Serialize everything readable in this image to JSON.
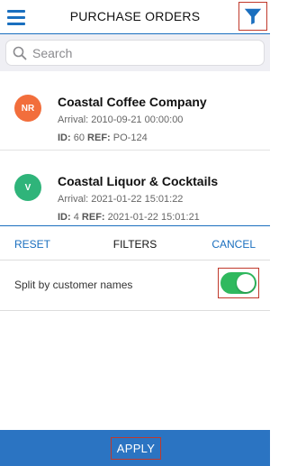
{
  "header": {
    "title": "PURCHASE ORDERS",
    "menu_icon": "hamburger-menu-icon",
    "filter_icon": "funnel-icon"
  },
  "search": {
    "placeholder": "Search",
    "icon": "search-icon"
  },
  "orders": [
    {
      "initials": "NR",
      "avatar_color": "#f26e3c",
      "name": "Coastal Coffee Company",
      "arrival": "Arrival: 2010-09-21 00:00:00",
      "id_label": "ID:",
      "id_value": "60",
      "ref_label": "REF:",
      "ref_value": "PO-124"
    },
    {
      "initials": "V",
      "avatar_color": "#2fb47a",
      "name": "Coastal Liquor & Cocktails",
      "arrival": "Arrival: 2021-01-22 15:01:22",
      "id_label": "ID:",
      "id_value": "4",
      "ref_label": "REF:",
      "ref_value": "2021-01-22 15:01:21"
    }
  ],
  "filters": {
    "reset_label": "RESET",
    "title": "FILTERS",
    "cancel_label": "CANCEL",
    "options": [
      {
        "label": "Split by customer names",
        "enabled": true
      }
    ],
    "apply_label": "APPLY"
  },
  "colors": {
    "accent": "#1a6fbf",
    "apply_bar": "#2b74c2",
    "toggle_on": "#2fb95e",
    "highlight": "#c0392b"
  }
}
